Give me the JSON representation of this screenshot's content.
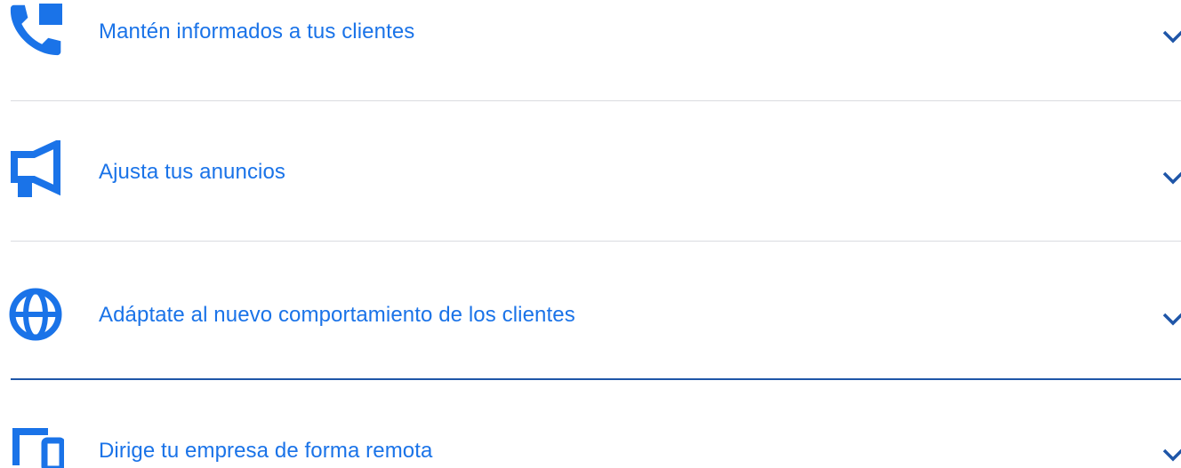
{
  "accordion": {
    "accent_color": "#1a73e8",
    "items": [
      {
        "label": "Mantén informados a tus clientes",
        "icon": "phone-forwarded-icon"
      },
      {
        "label": "Ajusta tus anuncios",
        "icon": "megaphone-icon"
      },
      {
        "label": "Adáptate al nuevo comportamiento de los clientes",
        "icon": "globe-icon"
      },
      {
        "label": "Dirige tu empresa de forma remota",
        "icon": "devices-icon"
      }
    ]
  }
}
